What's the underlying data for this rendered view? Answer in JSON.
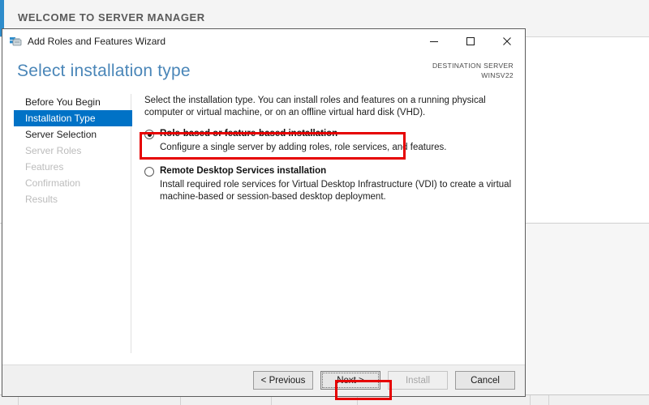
{
  "background": {
    "welcome_title": "WELCOME TO SERVER MANAGER",
    "accent_color": "#2e8ccb"
  },
  "wizard": {
    "titlebar": {
      "icon": "server-wizard-icon",
      "title": "Add Roles and Features Wizard",
      "minimize_label": "Minimize",
      "maximize_label": "Maximize",
      "close_label": "Close"
    },
    "header": {
      "heading": "Select installation type",
      "heading_color": "#4a86b8",
      "destination_label": "DESTINATION SERVER",
      "destination_server": "WINSV22"
    },
    "nav": {
      "items": [
        {
          "label": "Before You Begin",
          "state": "enabled"
        },
        {
          "label": "Installation Type",
          "state": "active"
        },
        {
          "label": "Server Selection",
          "state": "enabled"
        },
        {
          "label": "Server Roles",
          "state": "disabled"
        },
        {
          "label": "Features",
          "state": "disabled"
        },
        {
          "label": "Confirmation",
          "state": "disabled"
        },
        {
          "label": "Results",
          "state": "disabled"
        }
      ],
      "active_color": "#0072c6"
    },
    "pane": {
      "intro": "Select the installation type. You can install roles and features on a running physical computer or virtual machine, or on an offline virtual hard disk (VHD).",
      "options": [
        {
          "label": "Role-based or feature-based installation",
          "description": "Configure a single server by adding roles, role services, and features.",
          "selected": true,
          "highlighted": true
        },
        {
          "label": "Remote Desktop Services installation",
          "description": "Install required role services for Virtual Desktop Infrastructure (VDI) to create a virtual machine-based or session-based desktop deployment.",
          "selected": false,
          "highlighted": false
        }
      ]
    },
    "footer": {
      "previous_label": "< Previous",
      "next_label": "Next >",
      "install_label": "Install",
      "cancel_label": "Cancel",
      "install_disabled": true,
      "next_focused": true
    },
    "annotations": {
      "highlight_color": "#e60000",
      "boxes": [
        "role-based-option",
        "next-button"
      ]
    }
  }
}
